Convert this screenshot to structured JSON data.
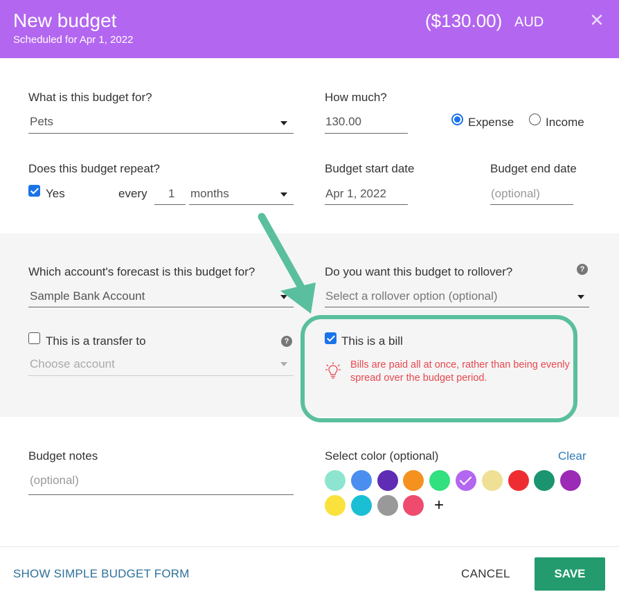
{
  "header": {
    "title": "New budget",
    "subtitle": "Scheduled for Apr 1, 2022",
    "amount": "($130.00)",
    "currency": "AUD",
    "close_icon": "close-icon"
  },
  "form": {
    "budget_for": {
      "label": "What is this budget for?",
      "value": "Pets"
    },
    "how_much": {
      "label": "How much?",
      "value": "130.00"
    },
    "type": {
      "expense_label": "Expense",
      "income_label": "Income",
      "selected": "Expense"
    },
    "repeat": {
      "label": "Does this budget repeat?",
      "checkbox_label": "Yes",
      "checked": true,
      "every_label": "every",
      "interval": "1",
      "unit": "months"
    },
    "start_date": {
      "label": "Budget start date",
      "value": "Apr 1, 2022"
    },
    "end_date": {
      "label": "Budget end date",
      "placeholder": "(optional)"
    },
    "account": {
      "label": "Which account's forecast is this budget for?",
      "value": "Sample Bank Account"
    },
    "rollover": {
      "label": "Do you want this budget to rollover?",
      "placeholder": "Select a rollover option (optional)",
      "help_icon": "?"
    },
    "transfer": {
      "checkbox_label": "This is a transfer to",
      "checked": false,
      "placeholder": "Choose account",
      "help_icon": "?"
    },
    "bill": {
      "checkbox_label": "This is a bill",
      "checked": true,
      "hint": "Bills are paid all at once, rather than being evenly spread over the budget period."
    },
    "notes": {
      "label": "Budget notes",
      "placeholder": "(optional)"
    },
    "color": {
      "label": "Select color (optional)",
      "clear_label": "Clear",
      "add_label": "+",
      "selected": "#b366f0",
      "swatches": [
        "#8de5cf",
        "#4a8ef0",
        "#5e2db3",
        "#f5911e",
        "#32e07f",
        "#b366f0",
        "#efe095",
        "#ee2d32",
        "#1b9470",
        "#9b2ab5",
        "#fbe13c",
        "#1bbfd4",
        "#999999",
        "#ef4b6e"
      ]
    }
  },
  "footer": {
    "simple_form_link": "SHOW SIMPLE BUDGET FORM",
    "cancel_label": "CANCEL",
    "save_label": "SAVE"
  },
  "colors": {
    "header_bg": "#b366f0",
    "highlight": "#5abf9e",
    "save_bg": "#239b6f",
    "hint": "#e8474f",
    "link": "#2e6f9a"
  }
}
